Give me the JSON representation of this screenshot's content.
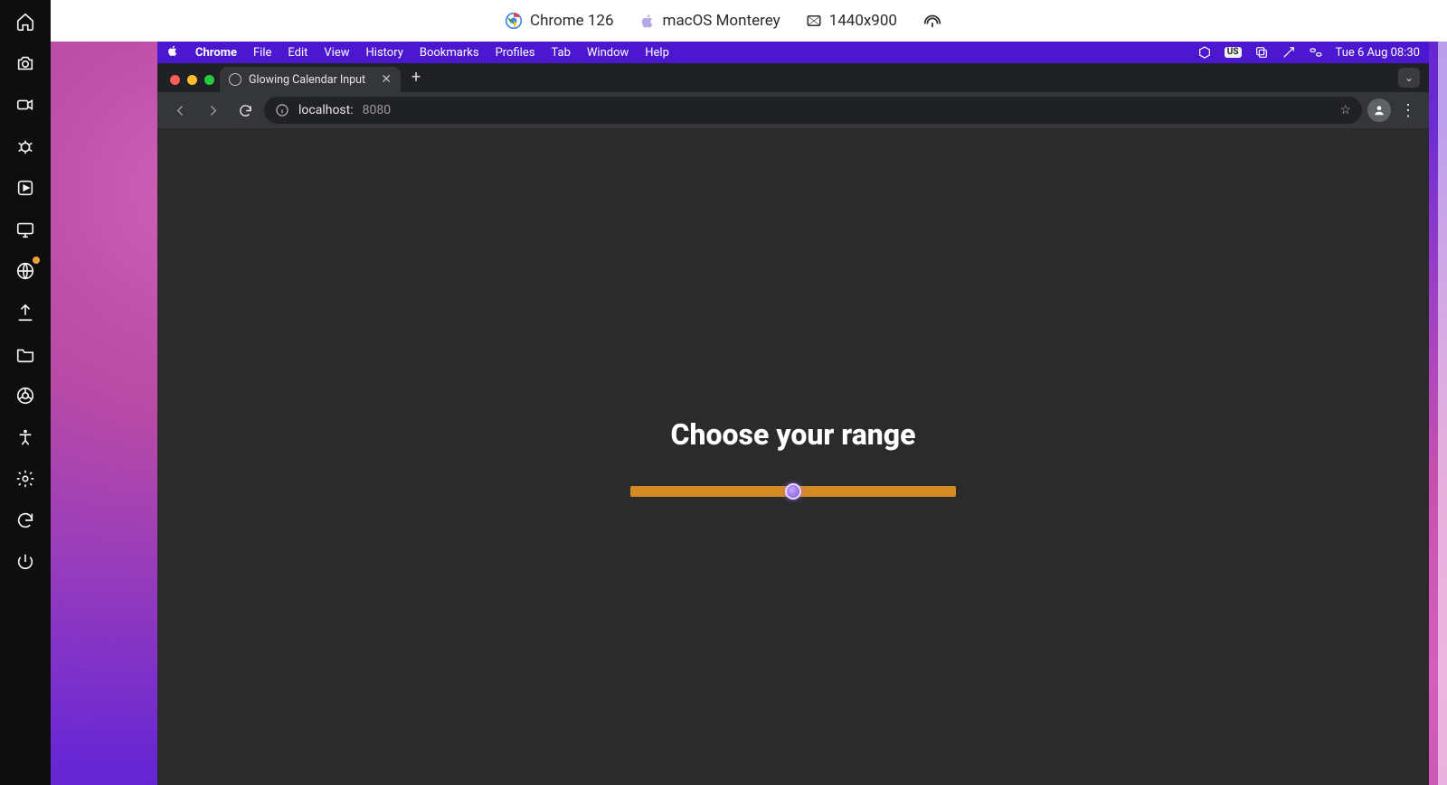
{
  "env_bar": {
    "browser": "Chrome 126",
    "os": "macOS Monterey",
    "resolution": "1440x900"
  },
  "tool_strip": {
    "items": [
      "home-icon",
      "camera-icon",
      "video-icon",
      "bug-icon",
      "play-square-icon",
      "monitor-icon",
      "globe-x-icon",
      "upload-icon",
      "folder-icon",
      "chrome-devtools-icon",
      "accessibility-icon",
      "settings-gear-icon",
      "sync-icon",
      "power-icon"
    ]
  },
  "mac_menu": {
    "app": "Chrome",
    "items": [
      "File",
      "Edit",
      "View",
      "History",
      "Bookmarks",
      "Profiles",
      "Tab",
      "Window",
      "Help"
    ],
    "input_badge": "US",
    "clock": "Tue 6 Aug  08:30"
  },
  "chrome": {
    "tab_title": "Glowing Calendar Input",
    "url_host": "localhost:",
    "url_port": "8080"
  },
  "page": {
    "heading": "Choose your range",
    "slider_value": 50,
    "slider_min": 0,
    "slider_max": 100
  },
  "colors": {
    "menubar": "#4b18cf",
    "slider_track": "#d58a22",
    "viewport_bg": "#2b2b2b"
  }
}
